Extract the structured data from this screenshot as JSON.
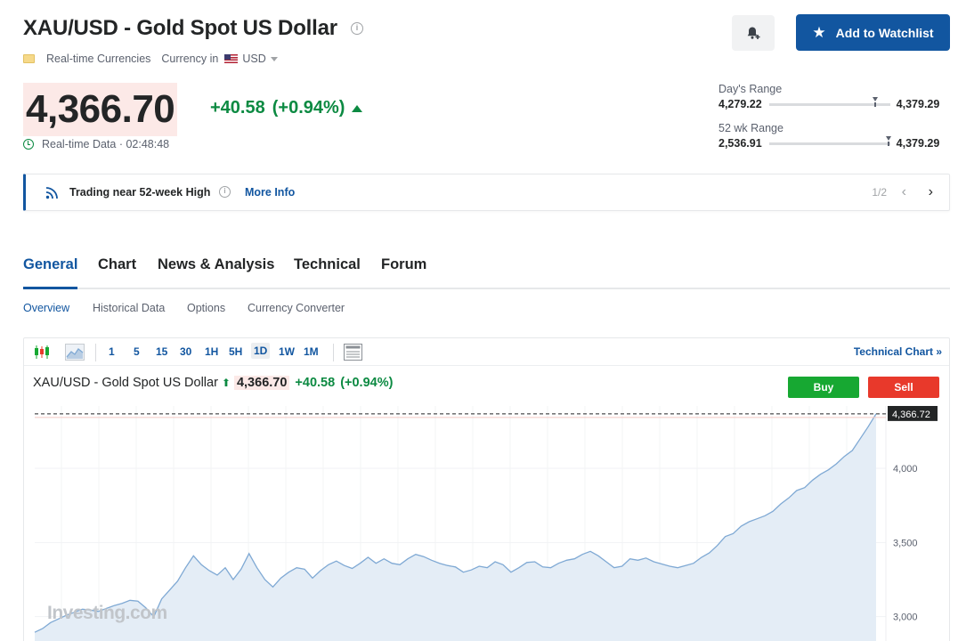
{
  "header": {
    "title": "XAU/USD - Gold Spot US Dollar",
    "category": "Real-time Currencies",
    "currency_label": "Currency in",
    "currency": "USD",
    "watchlist_label": "Add to Watchlist"
  },
  "quote": {
    "price": "4,366.70",
    "change": "+40.58",
    "change_pct": "(+0.94%)",
    "realtime_label": "Real-time Data · 02:48:48"
  },
  "ranges": {
    "day": {
      "label": "Day's Range",
      "low": "4,279.22",
      "high": "4,379.29",
      "position": 0.88
    },
    "week52": {
      "label": "52 wk Range",
      "low": "2,536.91",
      "high": "4,379.29",
      "position": 0.99
    }
  },
  "alert": {
    "text": "Trading near 52-week High",
    "link": "More Info",
    "page": "1/2"
  },
  "tabs": [
    "General",
    "Chart",
    "News & Analysis",
    "Technical",
    "Forum"
  ],
  "subtabs": [
    "Overview",
    "Historical Data",
    "Options",
    "Currency Converter"
  ],
  "toolbar": {
    "intervals": [
      "1",
      "5",
      "15",
      "30",
      "1H",
      "5H",
      "1D",
      "1W",
      "1M"
    ],
    "selected": "1D",
    "technical_chart": "Technical Chart »"
  },
  "chart_header": {
    "name": "XAU/USD - Gold Spot US Dollar",
    "price": "4,366.70",
    "change": "+40.58",
    "change_pct": "(+0.94%)",
    "buy": "Buy",
    "sell": "Sell"
  },
  "colors": {
    "accent": "#1256a0",
    "positive": "#0c8a42",
    "buy": "#17a832",
    "sell": "#e8392b",
    "series_line": "#7fa9d4",
    "series_fill": "#e4edf6"
  },
  "chart_data": {
    "type": "area",
    "yticks": [
      3000,
      3500,
      4000
    ],
    "ylim": [
      2830,
      4420
    ],
    "last_value_label": "4,366.72",
    "last_value": 4366.72,
    "watermark": "Investing.com",
    "values": [
      2895,
      2920,
      2960,
      2985,
      3010,
      3030,
      3050,
      3045,
      3035,
      3055,
      3075,
      3090,
      3110,
      3105,
      3060,
      3000,
      3120,
      3180,
      3240,
      3330,
      3410,
      3350,
      3310,
      3280,
      3330,
      3250,
      3320,
      3425,
      3330,
      3250,
      3200,
      3260,
      3300,
      3330,
      3320,
      3260,
      3310,
      3350,
      3375,
      3345,
      3325,
      3360,
      3400,
      3360,
      3390,
      3360,
      3350,
      3390,
      3420,
      3405,
      3380,
      3360,
      3345,
      3335,
      3300,
      3315,
      3340,
      3330,
      3370,
      3350,
      3300,
      3330,
      3365,
      3370,
      3335,
      3330,
      3360,
      3380,
      3390,
      3420,
      3440,
      3410,
      3370,
      3330,
      3340,
      3390,
      3380,
      3395,
      3370,
      3355,
      3340,
      3330,
      3345,
      3360,
      3400,
      3430,
      3480,
      3540,
      3560,
      3610,
      3640,
      3660,
      3680,
      3710,
      3760,
      3800,
      3850,
      3870,
      3920,
      3960,
      3990,
      4030,
      4080,
      4120,
      4200,
      4280,
      4367
    ]
  }
}
